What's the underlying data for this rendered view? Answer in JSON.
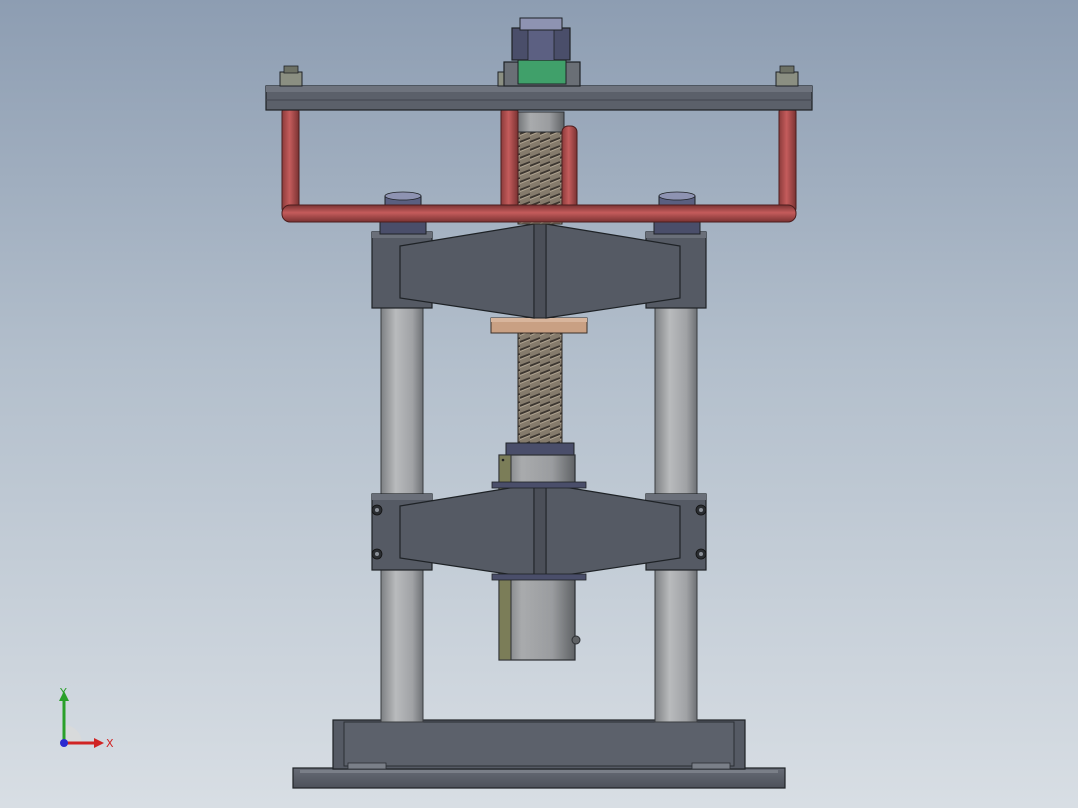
{
  "viewport": {
    "background_top": "#8d9db2",
    "background_bottom": "#d8dee4"
  },
  "model": {
    "colors": {
      "frame": "#555a64",
      "frame_edge": "#1e2226",
      "rod": "#a7a9ab",
      "handle": "#b24f4f",
      "thread": "#7d7466",
      "bronze": "#c9a083",
      "nut": "#4a4e6a"
    }
  },
  "triad": {
    "x_label": "X",
    "y_label": "Y",
    "x_color": "#d02424",
    "y_color": "#2aa02a",
    "z_color": "#2a2ad0"
  }
}
